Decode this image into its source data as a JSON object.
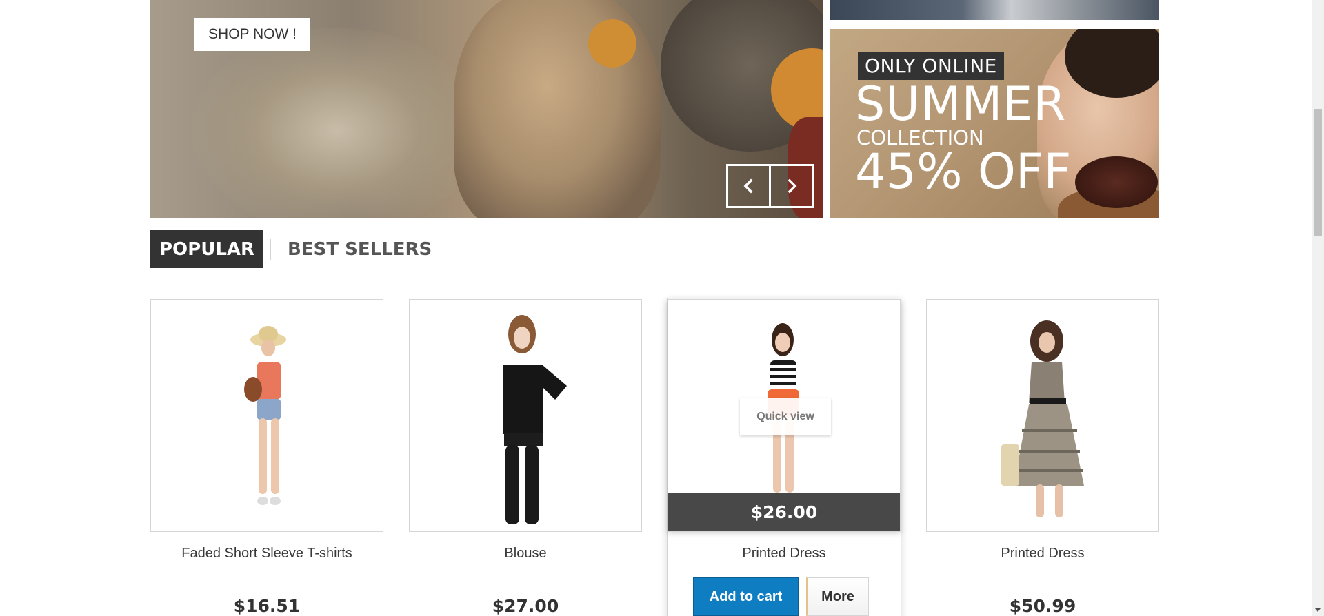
{
  "hero": {
    "shop_now_label": "SHOP NOW !",
    "prev_icon": "chevron-left-icon",
    "next_icon": "chevron-right-icon"
  },
  "banner": {
    "only_online": "ONLY ONLINE",
    "summer": "SUMMER",
    "collection": "COLLECTION",
    "discount": "45% OFF"
  },
  "tabs": [
    {
      "label": "POPULAR",
      "active": true
    },
    {
      "label": "BEST SELLERS",
      "active": false
    }
  ],
  "products": [
    {
      "name": "Faded Short Sleeve T-shirts",
      "price": "$16.51"
    },
    {
      "name": "Blouse",
      "price": "$27.00"
    },
    {
      "name": "Printed Dress",
      "price": "$26.00",
      "quick_view": "Quick view",
      "add_to_cart": "Add to cart",
      "more": "More"
    },
    {
      "name": "Printed Dress",
      "price": "$50.99"
    }
  ],
  "colors": {
    "accent_blue": "#0f7dc2",
    "dark": "#333333",
    "price_bar": "#484848"
  }
}
